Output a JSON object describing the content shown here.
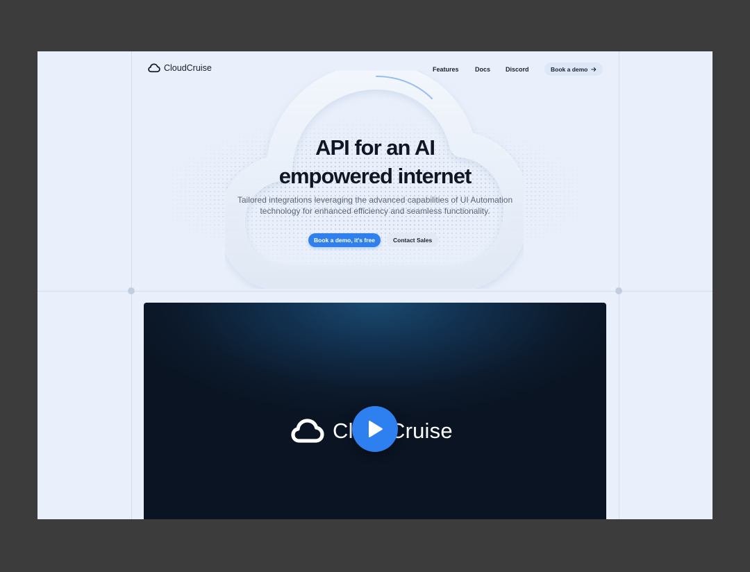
{
  "brand": {
    "name": "CloudCruise",
    "icon": "cloud-icon"
  },
  "nav": {
    "links": [
      {
        "label": "Features"
      },
      {
        "label": "Docs"
      },
      {
        "label": "Discord"
      }
    ],
    "cta_label": "Book a demo",
    "cta_icon": "arrow-right-icon"
  },
  "hero": {
    "title_line1": "API for an AI",
    "title_line2": "empowered internet",
    "subtitle_line1": "Tailored integrations leveraging the advanced capabilities of UI Automation",
    "subtitle_line2": "technology for enhanced efficiency and seamless functionality.",
    "primary_cta": "Book a demo, it's free",
    "secondary_cta": "Contact Sales"
  },
  "video": {
    "logo_text": "CloudCruise",
    "play_icon": "play-icon"
  },
  "colors": {
    "page_bg": "#e9f0fb",
    "accent": "#2f80ed",
    "video_bg": "#0c1a2c",
    "text": "#111524"
  }
}
